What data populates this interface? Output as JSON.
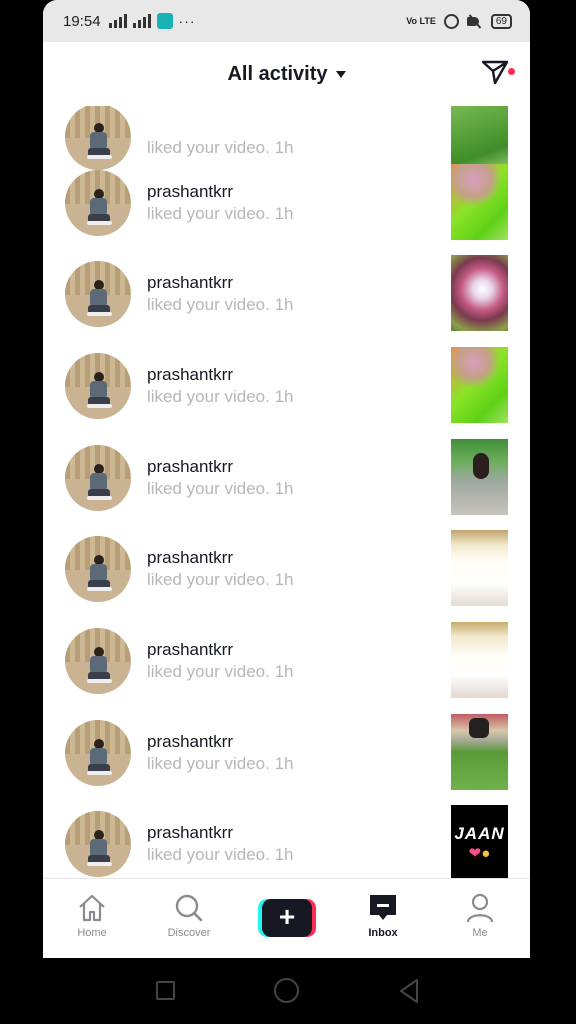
{
  "status_bar": {
    "time": "19:54",
    "extra": "···",
    "volte": "Vo LTE",
    "battery": "69"
  },
  "header": {
    "title": "All activity"
  },
  "activity": {
    "items": [
      {
        "user": "",
        "action": "liked your video. 1h",
        "thumb": "t1"
      },
      {
        "user": "prashantkrr",
        "action": "liked your video. 1h",
        "thumb": "t2"
      },
      {
        "user": "prashantkrr",
        "action": "liked your video. 1h",
        "thumb": "t3"
      },
      {
        "user": "prashantkrr",
        "action": "liked your video. 1h",
        "thumb": "t4"
      },
      {
        "user": "prashantkrr",
        "action": "liked your video. 1h",
        "thumb": "t5"
      },
      {
        "user": "prashantkrr",
        "action": "liked your video. 1h",
        "thumb": "t6"
      },
      {
        "user": "prashantkrr",
        "action": "liked your video. 1h",
        "thumb": "t7"
      },
      {
        "user": "prashantkrr",
        "action": "liked your video. 1h",
        "thumb": "t8"
      },
      {
        "user": "prashantkrr",
        "action": "liked your video. 1h",
        "thumb": "t9"
      }
    ],
    "last_thumb_text": "JAAN"
  },
  "tabbar": {
    "home": "Home",
    "discover": "Discover",
    "add": "+",
    "inbox": "Inbox",
    "me": "Me"
  },
  "colors": {
    "accent_red": "#fe2c55",
    "accent_cyan": "#25f4ee",
    "text_dark": "#161823",
    "text_gray": "#b5b7bb"
  }
}
